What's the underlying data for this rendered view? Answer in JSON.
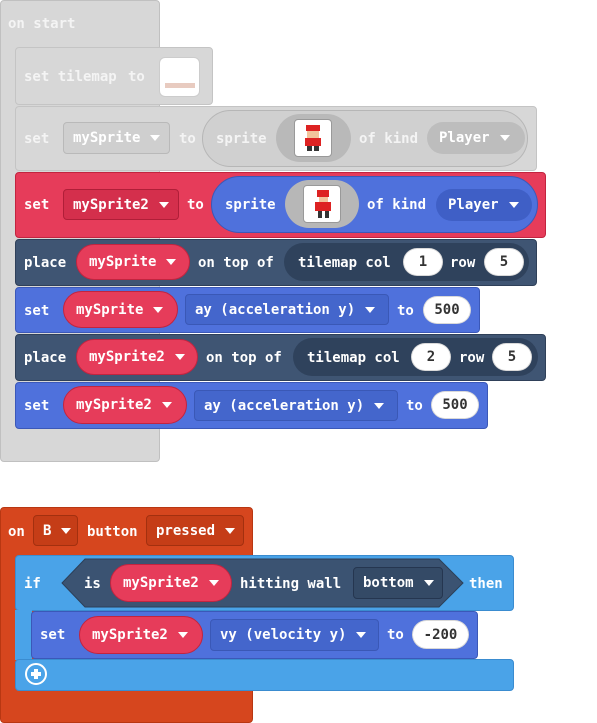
{
  "on_start": {
    "label": "on start",
    "set_tilemap": {
      "set": "set tilemap",
      "to": "to"
    },
    "set_mysprite": {
      "set": "set",
      "var": "mySprite",
      "to": "to",
      "sprite": "sprite",
      "of_kind": "of kind",
      "kind": "Player"
    },
    "set_mysprite2": {
      "set": "set",
      "var": "mySprite2",
      "to": "to",
      "sprite": "sprite",
      "of_kind": "of kind",
      "kind": "Player"
    },
    "place1": {
      "place": "place",
      "var": "mySprite",
      "on_top_of": "on top of",
      "tilemap_col": "tilemap col",
      "col": "1",
      "row_label": "row",
      "row": "5"
    },
    "set_ay1": {
      "set": "set",
      "var": "mySprite",
      "prop": "ay (acceleration y)",
      "to": "to",
      "value": "500"
    },
    "place2": {
      "place": "place",
      "var": "mySprite2",
      "on_top_of": "on top of",
      "tilemap_col": "tilemap col",
      "col": "2",
      "row_label": "row",
      "row": "5"
    },
    "set_ay2": {
      "set": "set",
      "var": "mySprite2",
      "prop": "ay (acceleration y)",
      "to": "to",
      "value": "500"
    }
  },
  "on_button": {
    "on": "on",
    "button": "B",
    "button_label": "button",
    "event": "pressed",
    "if_block": {
      "if": "if",
      "is": "is",
      "var": "mySprite2",
      "hitting_wall": "hitting wall",
      "direction": "bottom",
      "then": "then"
    },
    "set_vy": {
      "set": "set",
      "var": "mySprite2",
      "prop": "vy (velocity y)",
      "to": "to",
      "value": "-200"
    }
  },
  "colors": {
    "disabled_bg": "#d4d4d4",
    "disabled_border": "#bdbdbd",
    "sprites_red": "#e63c5a",
    "sprites_red_dark": "#c2243f",
    "scene_navy": "#3f5573",
    "sprites_blue": "#4f71dc",
    "event_orange": "#d6461e",
    "logic_lightblue": "#4aa3e8",
    "logic_navy": "#3b5372"
  }
}
